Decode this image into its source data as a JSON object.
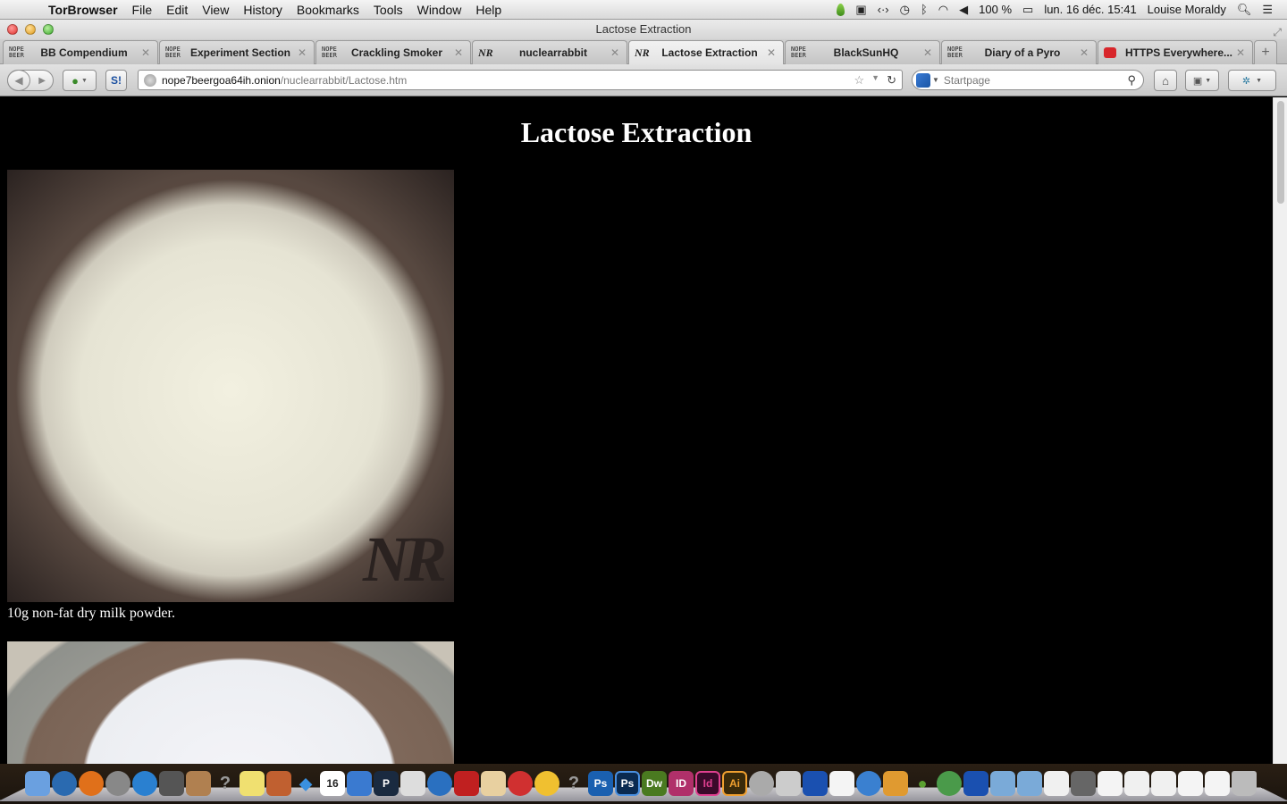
{
  "menubar": {
    "app_name": "TorBrowser",
    "menus": [
      "File",
      "Edit",
      "View",
      "History",
      "Bookmarks",
      "Tools",
      "Window",
      "Help"
    ],
    "battery": "100 %",
    "datetime": "lun. 16 déc.  15:41",
    "user": "Louise Moraldy"
  },
  "window": {
    "title": "Lactose Extraction"
  },
  "tabs": [
    {
      "label": "BB Compendium",
      "favicon": "nope-beer",
      "active": false
    },
    {
      "label": "Experiment Section",
      "favicon": "nope-beer",
      "active": false
    },
    {
      "label": "Crackling Smoker",
      "favicon": "nope-beer",
      "active": false
    },
    {
      "label": "nuclearrabbit",
      "favicon": "nr",
      "active": false
    },
    {
      "label": "Lactose Extraction",
      "favicon": "nr",
      "active": true
    },
    {
      "label": "BlackSunHQ",
      "favicon": "nope-beer",
      "active": false
    },
    {
      "label": "Diary of a Pyro",
      "favicon": "nope-beer",
      "active": false
    },
    {
      "label": "HTTPS Everywhere...",
      "favicon": "https-everywhere",
      "active": false
    }
  ],
  "favicon_text": {
    "nope_beer": "NOPE BEER",
    "nr": "NR"
  },
  "toolbar": {
    "url_host": "nope7beergoa64ih.onion",
    "url_path": "/nuclearrabbit/Lactose.htm",
    "search_placeholder": "Startpage"
  },
  "page": {
    "heading": "Lactose Extraction",
    "images": [
      {
        "alt": "Pile of non-fat dry milk powder in a bowl",
        "watermark": "NR",
        "caption": "10g non-fat dry milk powder."
      },
      {
        "alt": "Milk solution in glass jar",
        "caption": ""
      }
    ]
  },
  "dock": {
    "apps": [
      "Finder",
      "Thunderbird",
      "Firefox",
      "Launchpad",
      "App Store",
      "Photo Booth",
      "Contacts",
      "Unknown",
      "Stickies",
      "Keynote",
      "Dropbox",
      "Calendar",
      "Numbers",
      "Pixelmator",
      "Printer",
      "iTunes",
      "Photo Booth",
      "Pages",
      "Tomato",
      "Cyberduck",
      "Unknown",
      "Ps",
      "Ps",
      "Dw",
      "ID",
      "Id",
      "Ai",
      "Automator",
      "Preview",
      "Growl",
      "TextEdit",
      "Safari",
      "Archive Utility",
      "Tor",
      "Vidalia",
      "Growl",
      "Folder",
      "Folder",
      "Window",
      "Window",
      "Window",
      "Window",
      "Window",
      "Window",
      "Window",
      "Trash"
    ],
    "calendar_day": "16"
  },
  "colors": {
    "page_bg": "#000000",
    "page_text": "#ffffff"
  }
}
